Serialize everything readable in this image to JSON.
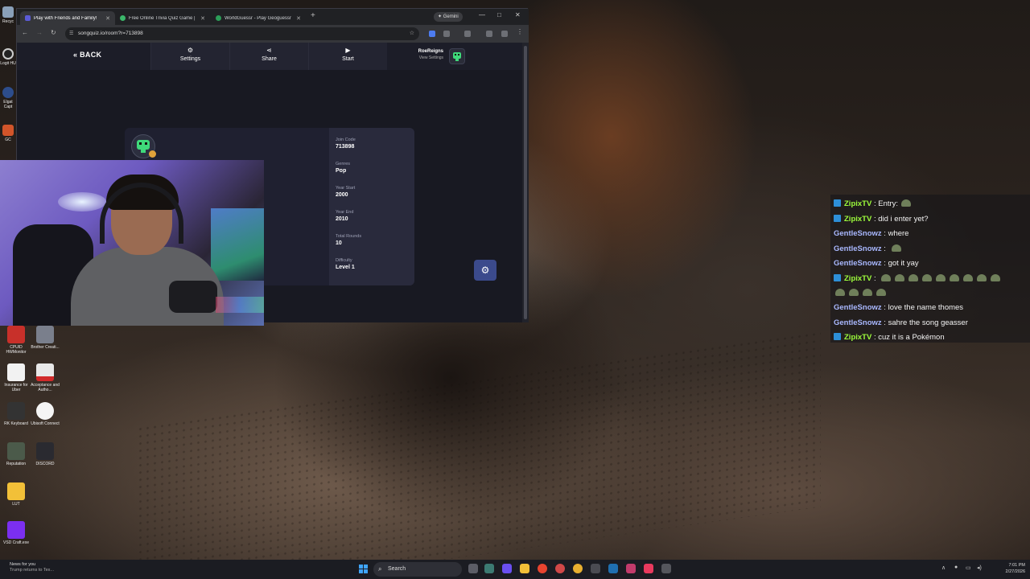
{
  "browser": {
    "tabs": [
      {
        "label": "Play with Friends and Family!",
        "active": true
      },
      {
        "label": "Free Online Trivia Quiz Game |",
        "active": false
      },
      {
        "label": "WorldGuessr - Play Geoguessr",
        "active": false
      }
    ],
    "gemini_label": "Gemini",
    "url": "songquiz.io/room?r=713898"
  },
  "app": {
    "back_label": "BACK",
    "nav": {
      "settings": "Settings",
      "share": "Share",
      "start": "Start"
    },
    "user": {
      "name": "RoeReigns",
      "sub": "View Settings"
    },
    "lobby": {
      "settings": [
        {
          "key": "Join Code",
          "value": "713898"
        },
        {
          "key": "Genres",
          "value": "Pop"
        },
        {
          "key": "Year Start",
          "value": "2000"
        },
        {
          "key": "Year End",
          "value": "2010"
        },
        {
          "key": "Total Rounds",
          "value": "10"
        },
        {
          "key": "Difficulty",
          "value": "Level 1"
        }
      ]
    }
  },
  "desktop_icons": [
    {
      "label": "CPUID HWMonitor"
    },
    {
      "label": "Brother Creati..."
    },
    {
      "label": "Insurance for Uber"
    },
    {
      "label": "Acceptance and Autho..."
    },
    {
      "label": "RK Keyboard"
    },
    {
      "label": "Ubisoft Connect"
    },
    {
      "label": "Reputation"
    },
    {
      "label": "DISCORD"
    },
    {
      "label": "LUT"
    },
    {
      "label": "VSD Craft.exe"
    },
    {
      "label": "Recyc"
    },
    {
      "label": "Logit HU"
    },
    {
      "label": "Elgat Capt"
    },
    {
      "label": "GC"
    }
  ],
  "chat": {
    "colors": {
      "ZipixTV": "#9dfc3c",
      "GentleSnowz": "#a9b8ff"
    },
    "messages": [
      {
        "user": "ZipixTV",
        "badge": true,
        "text": "Entry:",
        "emotes": 1
      },
      {
        "user": "ZipixTV",
        "badge": true,
        "text": "did i enter yet?",
        "emotes": 0
      },
      {
        "user": "GentleSnowz",
        "badge": false,
        "text": "where",
        "emotes": 0
      },
      {
        "user": "GentleSnowz",
        "badge": false,
        "text": "",
        "emotes": 1
      },
      {
        "user": "GentleSnowz",
        "badge": false,
        "text": "got it yay",
        "emotes": 0
      },
      {
        "user": "ZipixTV",
        "badge": true,
        "text": "",
        "emotes": 13
      },
      {
        "user": "GentleSnowz",
        "badge": false,
        "text": "love the name thomes",
        "emotes": 0
      },
      {
        "user": "GentleSnowz",
        "badge": false,
        "text": "sahre the song geasser",
        "emotes": 0
      },
      {
        "user": "ZipixTV",
        "badge": true,
        "text": "cuz it is a Pokémon",
        "emotes": 0
      }
    ]
  },
  "taskbar": {
    "news_title": "News for you",
    "news_sub": "Trump returns to Tex...",
    "search_placeholder": "Search",
    "time": "7:01 PM",
    "date": "2/27/2026"
  }
}
